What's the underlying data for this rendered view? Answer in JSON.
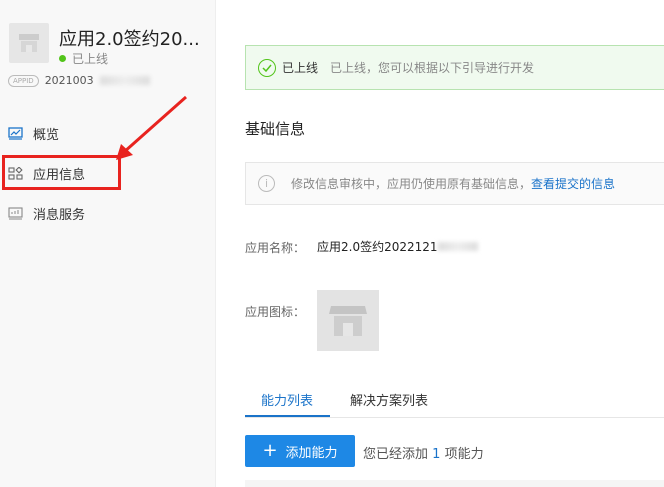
{
  "sidebar": {
    "app_name": "应用2.0签约20...",
    "app_status": "已上线",
    "app_id_tag": "APPID",
    "app_id_prefix": "2021003",
    "nav": [
      {
        "label": "概览",
        "icon": "dashboard-icon"
      },
      {
        "label": "应用信息",
        "icon": "apps-icon"
      },
      {
        "label": "消息服务",
        "icon": "message-service-icon"
      }
    ]
  },
  "main": {
    "status_bar": {
      "state": "已上线",
      "message": "已上线，您可以根据以下引导进行开发"
    },
    "section_title": "基础信息",
    "notice": {
      "text": "修改信息审核中，应用仍使用原有基础信息，",
      "link": "查看提交的信息"
    },
    "fields": {
      "name_label": "应用名称：",
      "name_value": "应用2.0签约2022121",
      "icon_label": "应用图标："
    },
    "tabs": [
      {
        "label": "能力列表",
        "active": true
      },
      {
        "label": "解决方案列表",
        "active": false
      }
    ],
    "add_button": "添加能力",
    "added_prefix": "您已经添加",
    "added_count": "1",
    "added_suffix": "项能力"
  },
  "colors": {
    "accent": "#1a73c9",
    "success": "#52c41a",
    "annotation": "#e8231f"
  }
}
